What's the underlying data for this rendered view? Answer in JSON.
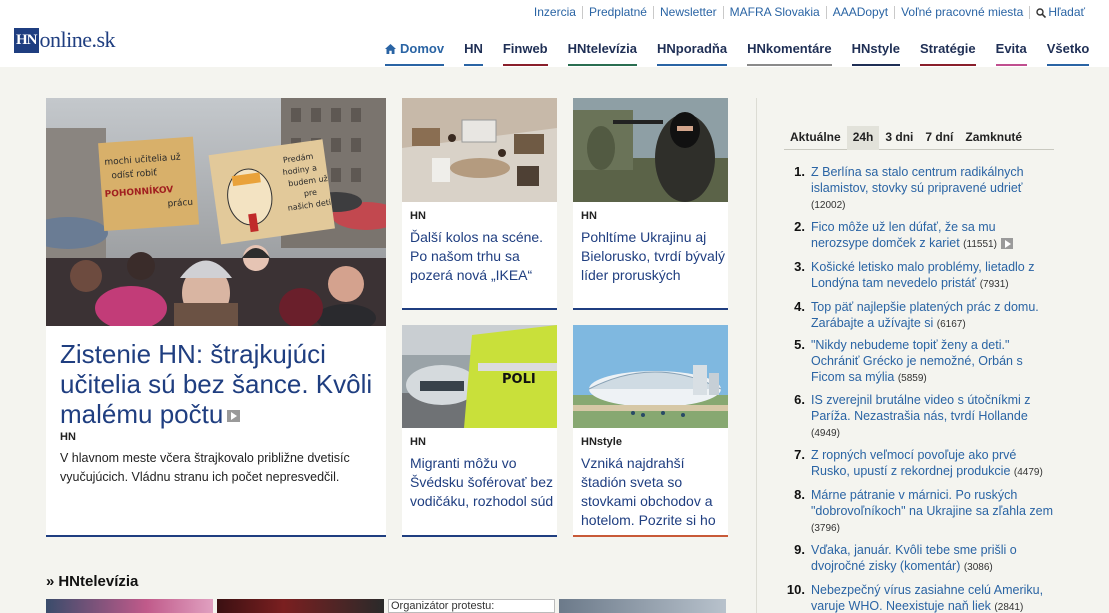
{
  "topbar": {
    "links": [
      "Inzercia",
      "Predplatné",
      "Newsletter",
      "MAFRA Slovakia",
      "AAADopyt",
      "Voľné pracovné miesta"
    ],
    "search_label": "Hľadať"
  },
  "logo": {
    "box": "HN",
    "text": "online.sk"
  },
  "nav": [
    {
      "label": "Domov",
      "color": "#2a64a4"
    },
    {
      "label": "HN",
      "color": "#2a64a4"
    },
    {
      "label": "Finweb",
      "color": "#8a1f2b"
    },
    {
      "label": "HNtelevízia",
      "color": "#2a6e50"
    },
    {
      "label": "HNporadňa",
      "color": "#2a64a4"
    },
    {
      "label": "HNkomentáre",
      "color": "#8a8a8a"
    },
    {
      "label": "HNstyle",
      "color": "#1f2f55"
    },
    {
      "label": "Stratégie",
      "color": "#8a1f2b"
    },
    {
      "label": "Evita",
      "color": "#c04f8f"
    },
    {
      "label": "Všetko",
      "color": "#2a64a4"
    }
  ],
  "lead": {
    "tag": "HN",
    "title": "Zistenie HN: štrajkujúci učitelia sú bez šance. Kvôli malému počtu",
    "perex": "V hlavnom meste včera štrajkovalo približne dvetisíc vyučujúcich. Vládnu stranu ich počet nepresvedčil.",
    "sign_text": [
      "mochi učitelia už",
      "odísť robiť",
      "POHONNÍKOV",
      "prácu"
    ],
    "sign2_text": [
      "Predám",
      "hodiny a",
      "budem už",
      "pre",
      "našich deti"
    ]
  },
  "articles": [
    {
      "tag": "HN",
      "title": "Ďalší kolos na scéne. Po našom trhu sa pozerá nová „IKEA“"
    },
    {
      "tag": "HN",
      "title": "Pohltíme Ukrajinu aj Bielorusko, tvrdí bývalý líder proruských"
    },
    {
      "tag": "HN",
      "title": "Migranti môžu vo Švédsku šoférovať bez vodičáku, rozhodol súd",
      "police_label": "POLI"
    },
    {
      "tag": "HNstyle",
      "title": "Vzniká najdrahší štadión sveta so stovkami obchodov a hotelom. Pozrite si ho"
    }
  ],
  "section": {
    "title": "HNtelevízia",
    "thumb_alt": "Organizátor protestu:"
  },
  "sidebar": {
    "tabs": [
      "Aktuálne",
      "24h",
      "3 dni",
      "7 dní",
      "Zamknuté"
    ],
    "active_tab": "24h",
    "top": [
      {
        "n": "1.",
        "text": "Z Berlína sa stalo centrum radikálnych islamistov, stovky sú pripravené udrieť",
        "count": "(12002)"
      },
      {
        "n": "2.",
        "text": "Fico môže už len dúfať, že sa mu nerozsype domček z kariet",
        "count": "(11551)",
        "video": true
      },
      {
        "n": "3.",
        "text": "Košické letisko malo problémy, lietadlo z Londýna tam nevedelo pristáť",
        "count": "(7931)"
      },
      {
        "n": "4.",
        "text": "Top päť najlepšie platených prác z domu. Zarábajte a užívajte si",
        "count": "(6167)"
      },
      {
        "n": "5.",
        "text": "\"Nikdy nebudeme topiť ženy a deti.\" Ochrániť Grécko je nemožné, Orbán s Ficom sa mýlia",
        "count": "(5859)"
      },
      {
        "n": "6.",
        "text": "IS zverejnil brutálne video s útočníkmi z Paríža. Nezastrašia nás, tvrdí Hollande",
        "count": "(4949)"
      },
      {
        "n": "7.",
        "text": "Z ropných veľmocí povoľuje ako prvé Rusko, upustí z rekordnej produkcie",
        "count": "(4479)"
      },
      {
        "n": "8.",
        "text": "Márne pátranie v márnici. Po ruských \"dobrovoľníkoch\" na Ukrajine sa zľahla zem",
        "count": "(3796)"
      },
      {
        "n": "9.",
        "text": "Vďaka, január. Kvôli tebe sme prišli o dvojročné zisky (komentár)",
        "count": "(3086)"
      },
      {
        "n": "10.",
        "text": "Nebezpečný vírus zasiahne celú Ameriku, varuje WHO. Neexistuje naň liek",
        "count": "(2841)"
      }
    ]
  }
}
